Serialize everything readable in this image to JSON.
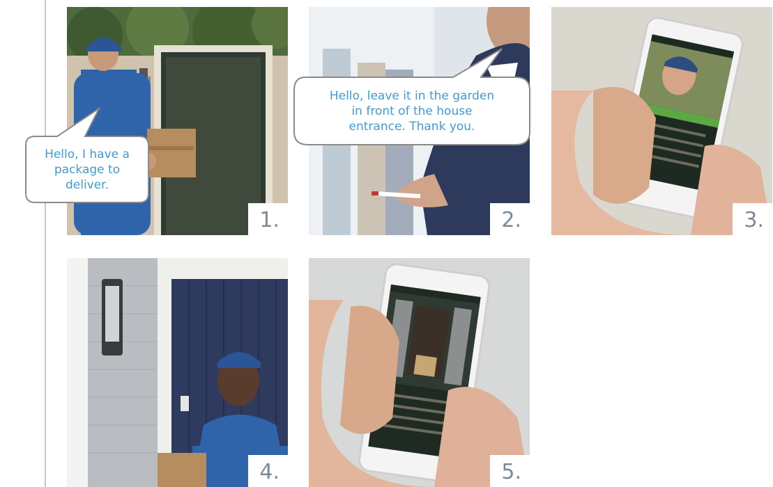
{
  "steps": [
    {
      "number": "1.",
      "icon": "courier-at-gate-photo"
    },
    {
      "number": "2.",
      "icon": "man-with-pen-photo"
    },
    {
      "number": "3.",
      "icon": "phone-video-call-photo"
    },
    {
      "number": "4.",
      "icon": "courier-at-door-camera-photo"
    },
    {
      "number": "5.",
      "icon": "phone-package-view-photo"
    }
  ],
  "bubbles": {
    "courier_text": "Hello, I have a package to deliver.",
    "owner_text": "Hello, leave it in the garden in front of the house entrance. Thank you."
  },
  "colors": {
    "bubble_text": "#3e9bd3",
    "step_number": "#7c8a98",
    "divider": "#c8c8c8"
  }
}
